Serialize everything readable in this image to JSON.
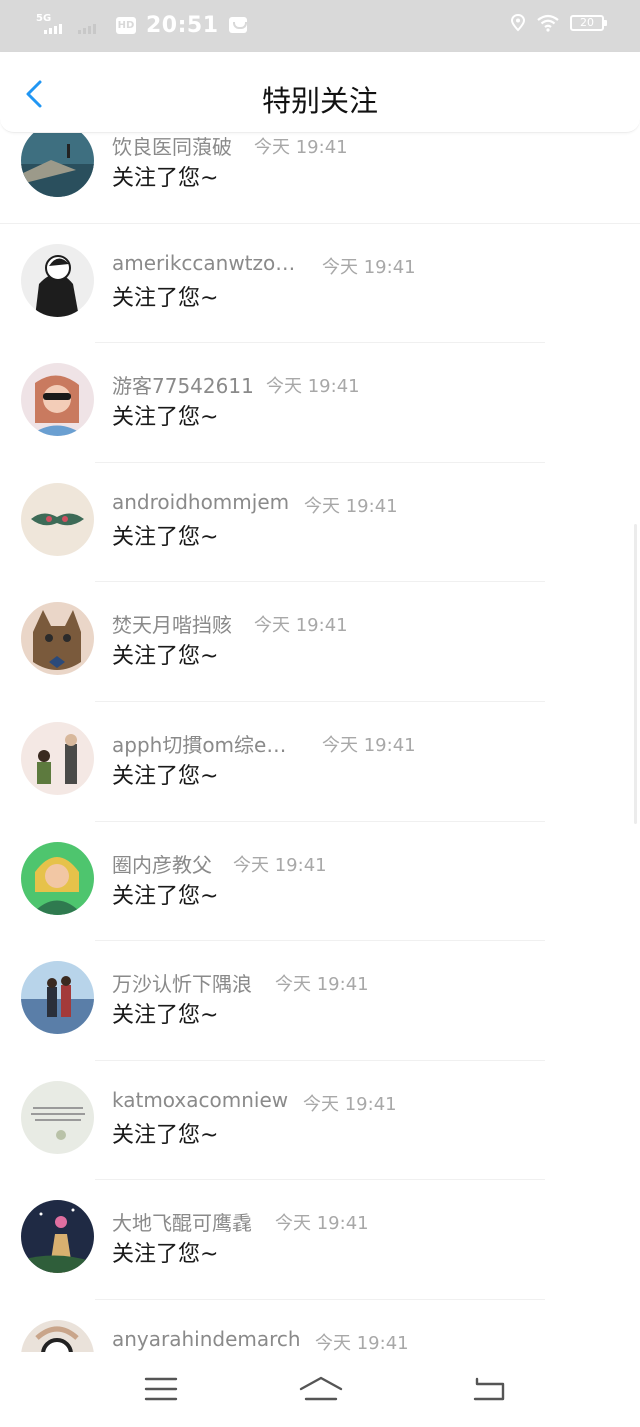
{
  "status_bar": {
    "network": "5G",
    "hd_badge": "HD",
    "time": "20:51",
    "battery": "20"
  },
  "header": {
    "back_icon": "chevron-left-icon",
    "title": "特别关注"
  },
  "list": {
    "items": [
      {
        "name": "饮良医同蒗破",
        "time": "今天 19:41",
        "message": "关注了您~"
      },
      {
        "name": "amerikccanwtzo…",
        "time": "今天 19:41",
        "message": "关注了您~"
      },
      {
        "name": "游客77542611",
        "time": "今天 19:41",
        "message": "关注了您~"
      },
      {
        "name": "androidhommjem",
        "time": "今天 19:41",
        "message": "关注了您~"
      },
      {
        "name": "焚天月喈挡赅",
        "time": "今天 19:41",
        "message": "关注了您~"
      },
      {
        "name": "apph切摜om综e…",
        "time": "今天 19:41",
        "message": "关注了您~"
      },
      {
        "name": "圈内彦教父",
        "time": "今天 19:41",
        "message": "关注了您~"
      },
      {
        "name": "万沙认忻下隅浪",
        "time": "今天 19:41",
        "message": "关注了您~"
      },
      {
        "name": "katmoxacomniew",
        "time": "今天 19:41",
        "message": "关注了您~"
      },
      {
        "name": "大地飞醌可鹰毳",
        "time": "今天 19:41",
        "message": "关注了您~"
      },
      {
        "name": "anyarahindemarch",
        "time": "今天 19:41",
        "message": ""
      }
    ]
  },
  "nav_bar": {
    "menu_icon": "menu-icon",
    "home_icon": "home-icon",
    "back_icon": "back-icon"
  },
  "colors": {
    "accent": "#2196f3",
    "status_bar_bg": "#d9d9d9",
    "name_text": "#8a8a8a",
    "message_text": "#1a1a1a"
  }
}
